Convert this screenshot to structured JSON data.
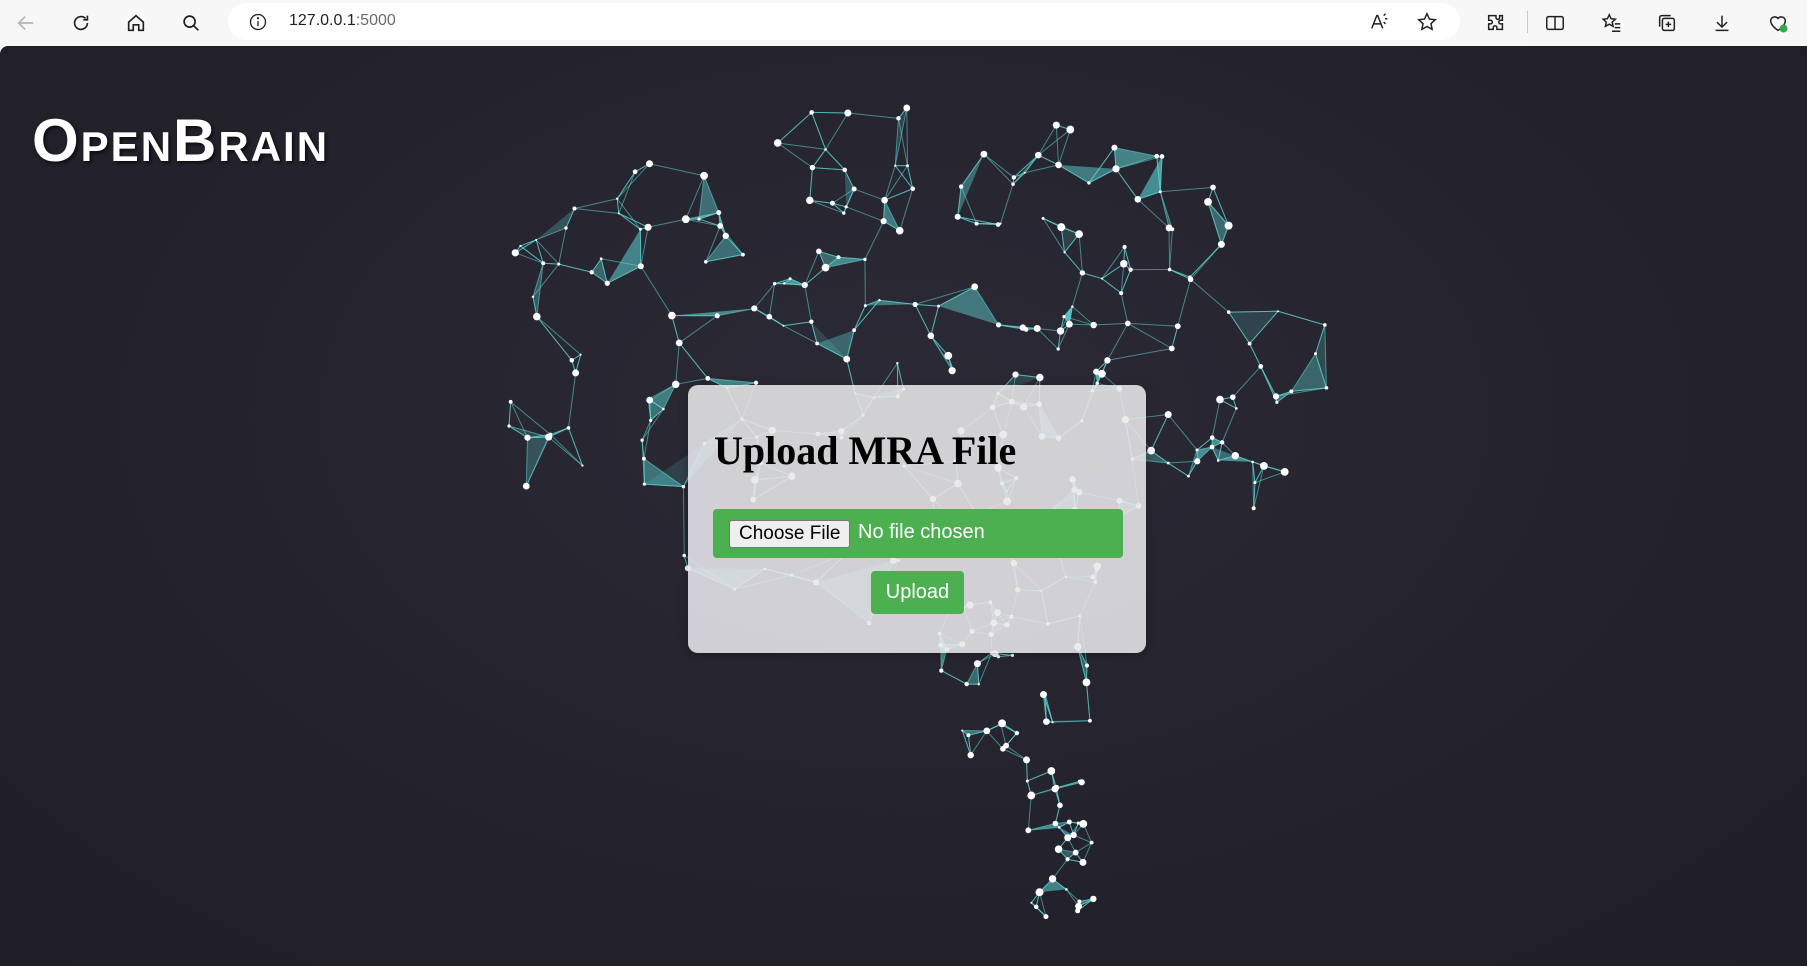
{
  "browser": {
    "url_host": "127.0.0.1",
    "url_port": ":5000",
    "icons": [
      "back-icon",
      "reload-icon",
      "home-icon",
      "search-icon",
      "site-info-icon",
      "read-aloud-icon",
      "favorite-star-icon",
      "extensions-icon",
      "split-screen-icon",
      "favorites-icon",
      "collections-icon",
      "downloads-icon",
      "browser-essentials-icon"
    ]
  },
  "page": {
    "logo": "OpenBrain",
    "background_color": "#24222c",
    "brain_color": "#5fd8d6"
  },
  "upload": {
    "title": "Upload MRA File",
    "choose_file_label": "Choose File",
    "no_file_text": "No file chosen",
    "upload_label": "Upload",
    "accent_color": "#4caf50"
  }
}
